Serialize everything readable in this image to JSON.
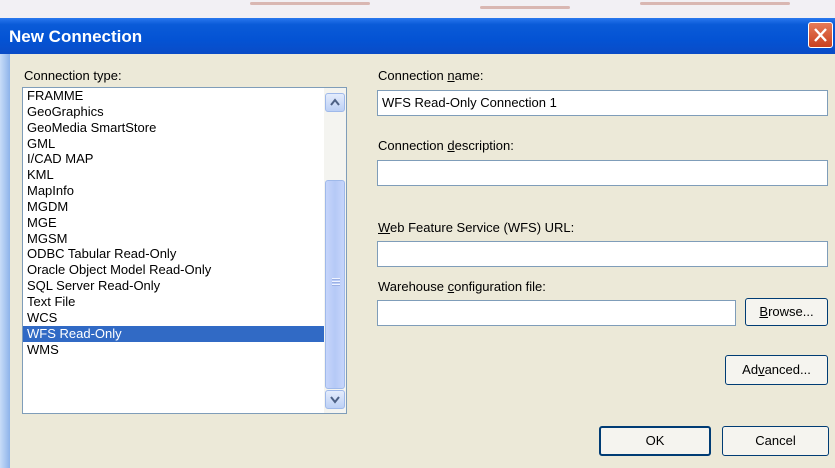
{
  "dialog": {
    "title": "New Connection",
    "close_icon": "close-x-icon",
    "colors": {
      "titlebar": "#0453d4",
      "selection": "#316ac5",
      "dialog_background": "#ece9d8",
      "close_button": "#d85535"
    }
  },
  "connection_type": {
    "label": "Connection type:",
    "items": [
      "FRAMME",
      "GeoGraphics",
      "GeoMedia SmartStore",
      "GML",
      "I/CAD MAP",
      "KML",
      "MapInfo",
      "MGDM",
      "MGE",
      "MGSM",
      "ODBC Tabular Read-Only",
      "Oracle Object Model Read-Only",
      "SQL Server Read-Only",
      "Text File",
      "WCS",
      "WFS Read-Only",
      "WMS"
    ],
    "selected": "WFS Read-Only",
    "scrollbar": {
      "up_icon": "chevron-up-icon",
      "down_icon": "chevron-down-icon"
    }
  },
  "connection_name": {
    "label_pre": "Connection ",
    "label_key": "n",
    "label_post": "ame:",
    "value": "WFS Read-Only Connection 1"
  },
  "connection_description": {
    "label_pre": "Connection ",
    "label_key": "d",
    "label_post": "escription:",
    "value": ""
  },
  "wfs_url": {
    "label_pre": "",
    "label_key": "W",
    "label_post": "eb Feature Service (WFS) URL:",
    "value": ""
  },
  "warehouse_config": {
    "label_pre": "Warehouse ",
    "label_key": "c",
    "label_post": "onfiguration file:",
    "value": ""
  },
  "buttons": {
    "browse_key": "B",
    "browse_rest": "rowse...",
    "advanced_pre": "Ad",
    "advanced_key": "v",
    "advanced_post": "anced...",
    "ok": "OK",
    "cancel": "Cancel"
  }
}
